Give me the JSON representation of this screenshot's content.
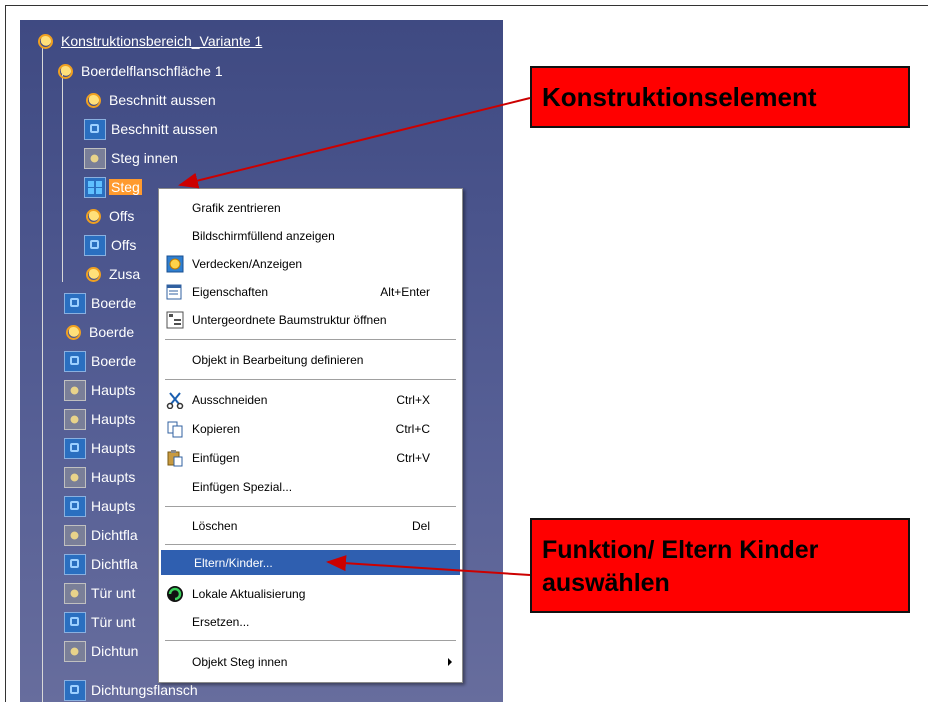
{
  "tree": {
    "root_label": "Konstruktionsbereich_Variante 1",
    "nodes": [
      {
        "label": "Boerdelflanschfläche 1",
        "icon": "feature-set-icon"
      },
      {
        "label": "Beschnitt aussen",
        "icon": "feature-set-icon"
      },
      {
        "label": "Beschnitt aussen",
        "icon": "surface-icon"
      },
      {
        "label": "Steg innen",
        "icon": "hidden-surface-icon"
      },
      {
        "label": "Steg",
        "icon": "body-icon"
      },
      {
        "label": "Offs",
        "icon": "feature-set-icon"
      },
      {
        "label": "Offs",
        "icon": "surface-icon"
      },
      {
        "label": "Zusa",
        "icon": "feature-set-icon"
      },
      {
        "label": "Boerde",
        "icon": "surface-icon"
      },
      {
        "label": "Boerde",
        "icon": "feature-set-icon"
      },
      {
        "label": "Boerde",
        "icon": "surface-icon"
      },
      {
        "label": "Haupts",
        "icon": "hidden-surface-icon"
      },
      {
        "label": "Haupts",
        "icon": "hidden-surface-icon"
      },
      {
        "label": "Haupts",
        "icon": "surface-icon"
      },
      {
        "label": "Haupts",
        "icon": "hidden-surface-icon"
      },
      {
        "label": "Haupts",
        "icon": "surface-icon"
      },
      {
        "label": "Dichtfla",
        "icon": "hidden-surface-icon"
      },
      {
        "label": "Dichtfla",
        "icon": "surface-icon"
      },
      {
        "label": "Tür unt",
        "icon": "hidden-surface-icon"
      },
      {
        "label": "Tür unt",
        "icon": "surface-icon"
      },
      {
        "label": "Dichtun",
        "icon": "hidden-surface-icon"
      },
      {
        "label": "Dichtungsflansch",
        "icon": "surface-icon"
      }
    ]
  },
  "context_menu": {
    "items": [
      {
        "label": "Grafik zentrieren",
        "shortcut": ""
      },
      {
        "label": "Bildschirmfüllend anzeigen",
        "shortcut": ""
      },
      {
        "label": "Verdecken/Anzeigen",
        "shortcut": "",
        "icon": "hide-show-icon"
      },
      {
        "label": "Eigenschaften",
        "shortcut": "Alt+Enter",
        "icon": "properties-icon"
      },
      {
        "label": "Untergeordnete Baumstruktur öffnen",
        "shortcut": "",
        "icon": "tree-icon"
      },
      {
        "label": "Objekt in Bearbeitung definieren",
        "shortcut": ""
      },
      {
        "label": "Ausschneiden",
        "shortcut": "Ctrl+X",
        "icon": "scissors-icon"
      },
      {
        "label": "Kopieren",
        "shortcut": "Ctrl+C",
        "icon": "copy-icon"
      },
      {
        "label": "Einfügen",
        "shortcut": "Ctrl+V",
        "icon": "paste-icon"
      },
      {
        "label": "Einfügen Spezial...",
        "shortcut": ""
      },
      {
        "label": "Löschen",
        "shortcut": "Del"
      },
      {
        "label": "Eltern/Kinder...",
        "shortcut": ""
      },
      {
        "label": "Lokale Aktualisierung",
        "shortcut": "",
        "icon": "update-icon"
      },
      {
        "label": "Ersetzen...",
        "shortcut": ""
      },
      {
        "label": "Objekt Steg innen",
        "shortcut": ""
      }
    ]
  },
  "callouts": {
    "construction_element": "Konstruktionselement",
    "function_line1": "Funktion/ Eltern Kinder",
    "function_line2": "auswählen"
  },
  "colors": {
    "callout_red": "#ff0000",
    "menu_highlight": "#2f5fb0",
    "node_highlight": "#ff9a2e",
    "arrow": "#cc0000"
  }
}
